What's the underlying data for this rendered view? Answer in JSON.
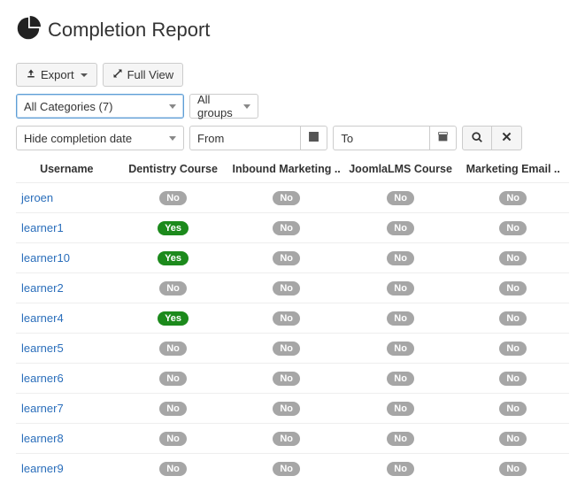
{
  "header": {
    "title": "Completion Report"
  },
  "toolbar": {
    "export_label": "Export",
    "fullview_label": "Full View"
  },
  "filters": {
    "category_label": "All Categories (7)",
    "groups_label": "All groups",
    "hide_completion_label": "Hide completion date",
    "from_label": "From",
    "to_label": "To",
    "from_value": "",
    "to_value": ""
  },
  "table": {
    "headers": {
      "username": "Username",
      "c1": "Dentistry Course",
      "c2": "Inbound Marketing ..",
      "c3": "JoomlaLMS Course",
      "c4": "Marketing Email .."
    },
    "rows": [
      {
        "user": "jeroen",
        "c1": "No",
        "c2": "No",
        "c3": "No",
        "c4": "No"
      },
      {
        "user": "learner1",
        "c1": "Yes",
        "c2": "No",
        "c3": "No",
        "c4": "No"
      },
      {
        "user": "learner10",
        "c1": "Yes",
        "c2": "No",
        "c3": "No",
        "c4": "No"
      },
      {
        "user": "learner2",
        "c1": "No",
        "c2": "No",
        "c3": "No",
        "c4": "No"
      },
      {
        "user": "learner4",
        "c1": "Yes",
        "c2": "No",
        "c3": "No",
        "c4": "No"
      },
      {
        "user": "learner5",
        "c1": "No",
        "c2": "No",
        "c3": "No",
        "c4": "No"
      },
      {
        "user": "learner6",
        "c1": "No",
        "c2": "No",
        "c3": "No",
        "c4": "No"
      },
      {
        "user": "learner7",
        "c1": "No",
        "c2": "No",
        "c3": "No",
        "c4": "No"
      },
      {
        "user": "learner8",
        "c1": "No",
        "c2": "No",
        "c3": "No",
        "c4": "No"
      },
      {
        "user": "learner9",
        "c1": "No",
        "c2": "No",
        "c3": "No",
        "c4": "No"
      }
    ]
  }
}
